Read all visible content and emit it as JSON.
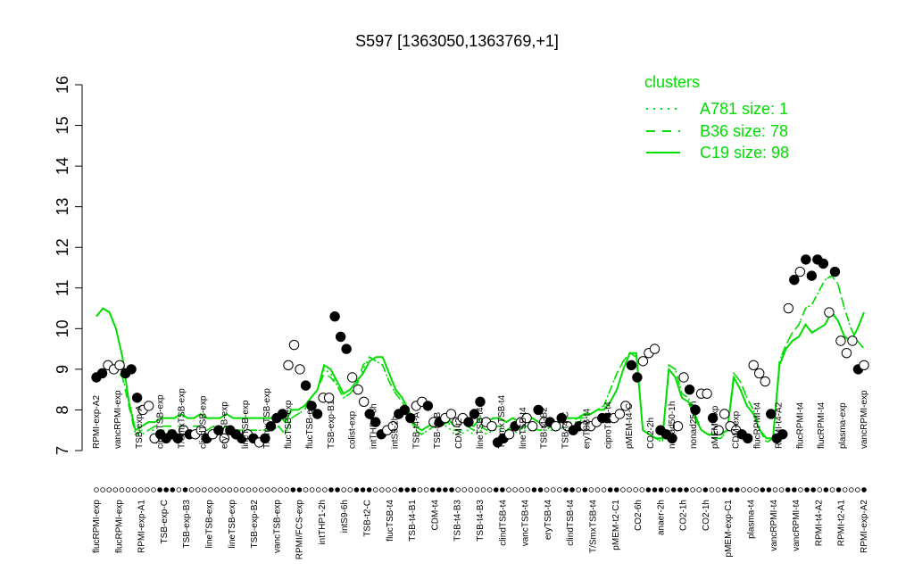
{
  "chart_data": {
    "type": "line",
    "title": "S597 [1363050,1363769,+1]",
    "xlabel": "",
    "ylabel": "",
    "ylim": [
      7,
      16
    ],
    "yticks": [
      7,
      8,
      9,
      10,
      11,
      12,
      13,
      14,
      15,
      16
    ],
    "grid": false,
    "legend_position": "top-right",
    "legend": {
      "title": "clusters",
      "entries": [
        {
          "label": "A781 size: 1",
          "style": "dotted"
        },
        {
          "label": "B36 size: 78",
          "style": "dashed"
        },
        {
          "label": "C19 size: 98",
          "style": "solid"
        }
      ]
    },
    "color": "#00dd00",
    "bottom_labels": [
      "flucRPMI-exp",
      "flucRPMI-exp",
      "RPMI-exp-A1",
      "TSB-exp-C",
      "TSB-exp-B3",
      "lineTSB-exp",
      "lineTSB-exp",
      "TSB-exp-B2",
      "vancTSB-exp",
      "RPMI/FCS-exp",
      "intTHP1-2h",
      "intS9-6h",
      "TSB-t2-C",
      "flucTSB-t4",
      "TSB-t4-B1",
      "CDM-t4",
      "TSB-t4-B3",
      "TSB-t4-B3",
      "clindTSB-t4",
      "vancTSB-t4",
      "eryTSB-t4",
      "clindTSB-t4",
      "T/SmxTSB-t4",
      "pMEM-t2-C1",
      "CO2-6h",
      "anaer-2h",
      "CO2-1h",
      "CO2-1h",
      "pMEM-exp-C1",
      "plasma-t4",
      "vancRPMI-t4",
      "vancRPMI-t4",
      "RPMI-t4-A2",
      "RPMI-t2-A1",
      "RPMI-exp-A2"
    ],
    "top_labels": [
      "RPMI-exp-A2",
      "vancRPMI-exp",
      "TSB-exp-A",
      "ciproTSB-exp",
      "T/SmxTSB-exp",
      "clindTSB-exp",
      "eryTSB-exp",
      "lineTSB-exp",
      "T/SmxTSB-exp",
      "flucTSB-exp",
      "flucTSB-exp",
      "TSB-exp-B1",
      "colist-exp",
      "intTHP1-6h",
      "intS9-2h",
      "TSB-t4-A",
      "TSB-t2-B",
      "CDM-t2",
      "lineTSB-t4",
      "T/SmxTSB-t4",
      "lineTSB-t4",
      "TSB-t4-B2",
      "TSB-t4-C",
      "eryTSB-t4",
      "ciproTSB-t4",
      "pMEM-t4-C",
      "CO2-2h",
      "nonad50-1h",
      "nonad25-1h",
      "pMEM-exp",
      "CDM-exp",
      "flucRPMI-t4",
      "RPMI-t4-A2",
      "flucRPMI-t4",
      "flucRPMI-t4",
      "plasma-exp",
      "vancRPMI-exp"
    ],
    "series": [
      {
        "style": "solid",
        "values": [
          10.3,
          10.5,
          10.4,
          10.0,
          9.3,
          8.2,
          7.5,
          7.6,
          7.7,
          7.7,
          7.8,
          7.8,
          7.8,
          7.9,
          7.8,
          7.8,
          7.9,
          7.8,
          7.8,
          7.8,
          7.9,
          7.8,
          7.8,
          7.8,
          7.8,
          7.8,
          7.8,
          7.8,
          7.9,
          7.7,
          8.0,
          8.0,
          8.1,
          8.3,
          8.5,
          9.1,
          9.0,
          8.7,
          8.4,
          8.5,
          8.7,
          8.9,
          9.2,
          9.3,
          9.3,
          8.9,
          8.5,
          8.3,
          8.0,
          7.6,
          7.5,
          7.6,
          7.7,
          7.8,
          7.8,
          7.6,
          7.7,
          7.7,
          7.6,
          7.8,
          7.7,
          7.8,
          7.8,
          7.7,
          7.8,
          7.7,
          7.8,
          7.8,
          7.7,
          7.7,
          7.7,
          7.7,
          7.8,
          7.8,
          7.8,
          7.9,
          7.9,
          8.0,
          8.0,
          8.2,
          8.5,
          9.0,
          9.4,
          9.4,
          7.5,
          7.4,
          7.3,
          7.3,
          9.0,
          8.8,
          8.3,
          8.2,
          7.8,
          7.5,
          7.4,
          7.4,
          7.4,
          7.5,
          8.8,
          8.5,
          8.1,
          7.9,
          7.5,
          7.3,
          7.3,
          9.1,
          9.5,
          9.7,
          9.8,
          10.1,
          9.9,
          10.0,
          10.1,
          10.4,
          10.2,
          9.8,
          9.7,
          10.0,
          10.4
        ]
      },
      {
        "style": "dashed",
        "values": [
          8.9,
          9.0,
          9.1,
          9.0,
          8.8,
          8.1,
          7.4,
          7.5,
          7.5,
          7.6,
          7.6,
          7.6,
          7.6,
          7.6,
          7.6,
          7.6,
          7.6,
          7.5,
          7.6,
          7.5,
          7.6,
          7.5,
          7.5,
          7.5,
          7.5,
          7.5,
          7.5,
          7.5,
          7.6,
          7.4,
          7.8,
          7.9,
          8.0,
          8.3,
          8.5,
          8.9,
          8.8,
          8.6,
          8.3,
          8.4,
          8.6,
          9.1,
          9.3,
          9.2,
          9.1,
          8.7,
          8.4,
          8.2,
          7.9,
          7.5,
          7.4,
          7.5,
          7.6,
          7.6,
          7.7,
          7.5,
          7.5,
          7.6,
          7.5,
          7.6,
          7.5,
          7.6,
          7.6,
          7.5,
          7.6,
          7.5,
          7.6,
          7.6,
          7.5,
          7.5,
          7.6,
          7.6,
          7.6,
          7.7,
          7.8,
          7.8,
          7.9,
          8.0,
          8.1,
          8.5,
          8.9,
          9.2,
          9.4,
          9.3,
          7.5,
          7.4,
          7.3,
          7.2,
          9.1,
          9.0,
          8.4,
          8.3,
          7.9,
          7.5,
          7.4,
          7.3,
          7.3,
          7.5,
          8.9,
          8.7,
          8.3,
          8.0,
          7.5,
          7.2,
          7.3,
          9.2,
          9.6,
          9.9,
          10.1,
          10.5,
          10.6,
          10.9,
          11.2,
          11.3,
          11.1,
          10.5,
          10.0,
          9.7,
          9.5
        ]
      },
      {
        "style": "dotted",
        "values": [
          8.8,
          8.9,
          9.1,
          9.0,
          8.8,
          8.2,
          7.4,
          7.4,
          7.5,
          7.5,
          7.5,
          7.5,
          7.5,
          7.5,
          7.5,
          7.5,
          7.5,
          7.5,
          7.5,
          7.5,
          7.5,
          7.5,
          7.5,
          7.5,
          7.5,
          7.5,
          7.5,
          7.5,
          7.6,
          7.4,
          7.8,
          7.9,
          8.0,
          8.3,
          8.5,
          9.0,
          8.9,
          8.6,
          8.3,
          8.4,
          8.6,
          9.0,
          9.3,
          9.2,
          9.1,
          8.7,
          8.4,
          8.2,
          7.9,
          7.5,
          7.4,
          7.5,
          7.6,
          7.6,
          7.6,
          7.4,
          7.4,
          7.5,
          7.4,
          7.5,
          7.4,
          7.5,
          7.5,
          7.5,
          7.5,
          7.4,
          7.5,
          7.5,
          7.5,
          7.5,
          7.5,
          7.5,
          7.6,
          7.7,
          7.7,
          7.8,
          7.9,
          8.0,
          8.1,
          8.5,
          8.9,
          9.2,
          9.4,
          9.3,
          7.5,
          7.4,
          7.3,
          7.2,
          9.1,
          9.0,
          8.4,
          8.3,
          7.9,
          7.5,
          7.4,
          7.3,
          7.3,
          7.5,
          8.9,
          8.7,
          8.3,
          8.0,
          7.5,
          7.2,
          7.3,
          9.2,
          9.6,
          9.9,
          10.1,
          10.5,
          10.6,
          10.9,
          11.2,
          11.3,
          11.1,
          10.5,
          10.0,
          9.7,
          9.5
        ]
      }
    ],
    "points": [
      {
        "y": 8.8,
        "filled": true
      },
      {
        "y": 8.9,
        "filled": true
      },
      {
        "y": 9.1,
        "filled": false
      },
      {
        "y": 9.0,
        "filled": false
      },
      {
        "y": 9.1,
        "filled": false
      },
      {
        "y": 8.9,
        "filled": true
      },
      {
        "y": 9.0,
        "filled": true
      },
      {
        "y": 8.3,
        "filled": true
      },
      {
        "y": 8.0,
        "filled": false
      },
      {
        "y": 8.1,
        "filled": false
      },
      {
        "y": 7.3,
        "filled": false
      },
      {
        "y": 7.4,
        "filled": true
      },
      {
        "y": 7.3,
        "filled": true
      },
      {
        "y": 7.4,
        "filled": true
      },
      {
        "y": 7.3,
        "filled": true
      },
      {
        "y": 7.5,
        "filled": false
      },
      {
        "y": 7.4,
        "filled": true
      },
      {
        "y": 7.4,
        "filled": false
      },
      {
        "y": 7.5,
        "filled": false
      },
      {
        "y": 7.3,
        "filled": true
      },
      {
        "y": 7.4,
        "filled": false
      },
      {
        "y": 7.5,
        "filled": true
      },
      {
        "y": 7.3,
        "filled": false
      },
      {
        "y": 7.5,
        "filled": true
      },
      {
        "y": 7.4,
        "filled": true
      },
      {
        "y": 7.3,
        "filled": true
      },
      {
        "y": 7.4,
        "filled": false
      },
      {
        "y": 7.3,
        "filled": true
      },
      {
        "y": 7.2,
        "filled": false
      },
      {
        "y": 7.3,
        "filled": true
      },
      {
        "y": 7.6,
        "filled": true
      },
      {
        "y": 7.8,
        "filled": true
      },
      {
        "y": 7.9,
        "filled": true
      },
      {
        "y": 9.1,
        "filled": false
      },
      {
        "y": 9.6,
        "filled": false
      },
      {
        "y": 9.0,
        "filled": false
      },
      {
        "y": 8.6,
        "filled": true
      },
      {
        "y": 8.1,
        "filled": true
      },
      {
        "y": 7.9,
        "filled": true
      },
      {
        "y": 8.3,
        "filled": false
      },
      {
        "y": 8.3,
        "filled": false
      },
      {
        "y": 10.3,
        "filled": true
      },
      {
        "y": 9.8,
        "filled": true
      },
      {
        "y": 9.5,
        "filled": true
      },
      {
        "y": 8.8,
        "filled": false
      },
      {
        "y": 8.5,
        "filled": false
      },
      {
        "y": 8.2,
        "filled": false
      },
      {
        "y": 7.9,
        "filled": true
      },
      {
        "y": 7.7,
        "filled": true
      },
      {
        "y": 7.4,
        "filled": true
      },
      {
        "y": 7.5,
        "filled": false
      },
      {
        "y": 7.6,
        "filled": false
      },
      {
        "y": 7.9,
        "filled": true
      },
      {
        "y": 8.0,
        "filled": true
      },
      {
        "y": 7.8,
        "filled": true
      },
      {
        "y": 8.1,
        "filled": false
      },
      {
        "y": 8.2,
        "filled": false
      },
      {
        "y": 8.1,
        "filled": true
      },
      {
        "y": 7.7,
        "filled": false
      },
      {
        "y": 7.7,
        "filled": true
      },
      {
        "y": 7.8,
        "filled": false
      },
      {
        "y": 7.9,
        "filled": false
      },
      {
        "y": 7.7,
        "filled": false
      },
      {
        "y": 7.8,
        "filled": false
      },
      {
        "y": 7.7,
        "filled": true
      },
      {
        "y": 7.9,
        "filled": true
      },
      {
        "y": 8.2,
        "filled": true
      },
      {
        "y": 7.7,
        "filled": false
      },
      {
        "y": 7.6,
        "filled": false
      },
      {
        "y": 7.2,
        "filled": true
      },
      {
        "y": 7.3,
        "filled": true
      },
      {
        "y": 7.4,
        "filled": false
      },
      {
        "y": 7.6,
        "filled": true
      },
      {
        "y": 7.7,
        "filled": false
      },
      {
        "y": 7.8,
        "filled": false
      },
      {
        "y": 7.6,
        "filled": false
      },
      {
        "y": 8.0,
        "filled": true
      },
      {
        "y": 7.7,
        "filled": false
      },
      {
        "y": 7.7,
        "filled": true
      },
      {
        "y": 7.6,
        "filled": false
      },
      {
        "y": 7.8,
        "filled": true
      },
      {
        "y": 7.6,
        "filled": false
      },
      {
        "y": 7.5,
        "filled": true
      },
      {
        "y": 7.6,
        "filled": true
      },
      {
        "y": 7.6,
        "filled": false
      },
      {
        "y": 7.6,
        "filled": false
      },
      {
        "y": 7.7,
        "filled": false
      },
      {
        "y": 7.8,
        "filled": true
      },
      {
        "y": 7.8,
        "filled": true
      },
      {
        "y": 7.8,
        "filled": false
      },
      {
        "y": 7.9,
        "filled": false
      },
      {
        "y": 8.1,
        "filled": false
      },
      {
        "y": 9.1,
        "filled": true
      },
      {
        "y": 8.8,
        "filled": true
      },
      {
        "y": 9.2,
        "filled": false
      },
      {
        "y": 9.4,
        "filled": false
      },
      {
        "y": 9.5,
        "filled": false
      },
      {
        "y": 7.5,
        "filled": true
      },
      {
        "y": 7.4,
        "filled": true
      },
      {
        "y": 7.3,
        "filled": true
      },
      {
        "y": 7.6,
        "filled": false
      },
      {
        "y": 8.8,
        "filled": false
      },
      {
        "y": 8.5,
        "filled": true
      },
      {
        "y": 8.0,
        "filled": true
      },
      {
        "y": 8.4,
        "filled": false
      },
      {
        "y": 8.4,
        "filled": false
      },
      {
        "y": 7.8,
        "filled": true
      },
      {
        "y": 7.5,
        "filled": false
      },
      {
        "y": 7.9,
        "filled": false
      },
      {
        "y": 7.6,
        "filled": false
      },
      {
        "y": 7.5,
        "filled": false
      },
      {
        "y": 7.4,
        "filled": true
      },
      {
        "y": 7.3,
        "filled": true
      },
      {
        "y": 9.1,
        "filled": false
      },
      {
        "y": 8.9,
        "filled": false
      },
      {
        "y": 8.7,
        "filled": false
      },
      {
        "y": 7.9,
        "filled": true
      },
      {
        "y": 7.3,
        "filled": true
      },
      {
        "y": 7.4,
        "filled": true
      },
      {
        "y": 10.5,
        "filled": false
      },
      {
        "y": 11.2,
        "filled": true
      },
      {
        "y": 11.4,
        "filled": false
      },
      {
        "y": 11.7,
        "filled": true
      },
      {
        "y": 11.3,
        "filled": true
      },
      {
        "y": 11.7,
        "filled": true
      },
      {
        "y": 11.6,
        "filled": true
      },
      {
        "y": 10.4,
        "filled": false
      },
      {
        "y": 11.4,
        "filled": true
      },
      {
        "y": 9.7,
        "filled": false
      },
      {
        "y": 9.4,
        "filled": false
      },
      {
        "y": 9.7,
        "filled": false
      },
      {
        "y": 9.0,
        "filled": true
      },
      {
        "y": 9.1,
        "filled": false
      }
    ],
    "rug": [
      0,
      0,
      0,
      0,
      0,
      0,
      0,
      0,
      0,
      0,
      1,
      1,
      1,
      0,
      1,
      0,
      0,
      0,
      0,
      0,
      0,
      0,
      0,
      0,
      0,
      0,
      0,
      0,
      0,
      0,
      0,
      1,
      1,
      0,
      0,
      0,
      0,
      1,
      1,
      0,
      0,
      1,
      1,
      1,
      0,
      0,
      0,
      0,
      1,
      1,
      1,
      0,
      0,
      1,
      1,
      1,
      1,
      0,
      0,
      0,
      0,
      0,
      0,
      1,
      1,
      0,
      0,
      0,
      0,
      1,
      1,
      0,
      0,
      0,
      1,
      1,
      0,
      1,
      0,
      0,
      0,
      1,
      1,
      0,
      0,
      0,
      0,
      1,
      1,
      1,
      0,
      1,
      1,
      1,
      0,
      0,
      1,
      0,
      0,
      1,
      1,
      1,
      0,
      0,
      0,
      1,
      1,
      0,
      0,
      1,
      1,
      0,
      1,
      1,
      0,
      1,
      0,
      1,
      0,
      0,
      0,
      1
    ]
  }
}
